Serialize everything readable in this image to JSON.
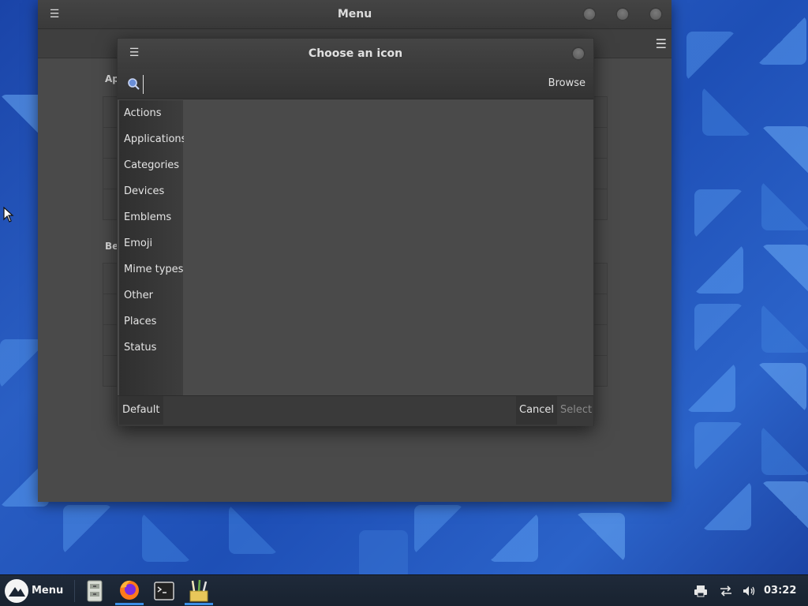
{
  "desktop": {
    "background_color": "#1e4fb6"
  },
  "background_window": {
    "title": "Menu",
    "section_label_1": "Ap",
    "section_label_2": "Be"
  },
  "dialog": {
    "title": "Choose an icon",
    "search": {
      "value": "",
      "placeholder": ""
    },
    "browse_label": "Browse",
    "categories": [
      {
        "label": "Actions"
      },
      {
        "label": "Applications"
      },
      {
        "label": "Categories"
      },
      {
        "label": "Devices"
      },
      {
        "label": "Emblems"
      },
      {
        "label": "Emoji"
      },
      {
        "label": "Mime types"
      },
      {
        "label": "Other"
      },
      {
        "label": "Places"
      },
      {
        "label": "Status"
      }
    ],
    "footer": {
      "default_label": "Default",
      "cancel_label": "Cancel",
      "select_label": "Select"
    }
  },
  "taskbar": {
    "menu_label": "Menu",
    "clock": "03:22",
    "apps": [
      {
        "icon": "file-cabinet-icon"
      },
      {
        "icon": "firefox-icon"
      },
      {
        "icon": "terminal-icon"
      },
      {
        "icon": "text-editor-icon"
      }
    ],
    "tray": [
      {
        "icon": "printer-icon"
      },
      {
        "icon": "network-icon"
      },
      {
        "icon": "volume-icon"
      }
    ]
  }
}
